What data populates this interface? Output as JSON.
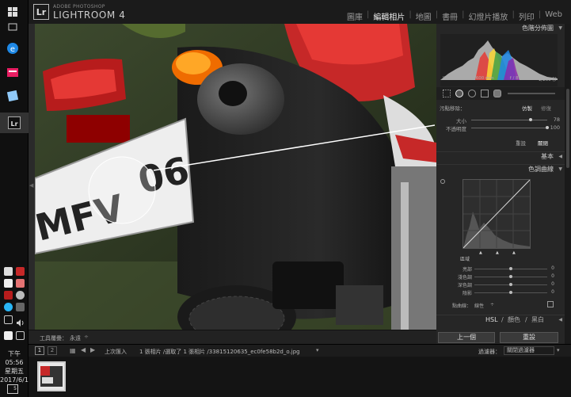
{
  "app": {
    "logo": "Lr",
    "brand_top": "ADOBE PHOTOSHOP",
    "brand_name": "LIGHTROOM 4"
  },
  "modules": [
    {
      "label": "圖庫",
      "active": false
    },
    {
      "label": "編輯相片",
      "active": true
    },
    {
      "label": "地圖",
      "active": false
    },
    {
      "label": "書冊",
      "active": false
    },
    {
      "label": "幻燈片播放",
      "active": false
    },
    {
      "label": "列印",
      "active": false
    },
    {
      "label": "Web",
      "active": false
    }
  ],
  "panel": {
    "histogram_title": "色階分佈圖",
    "histogram_info": [
      "ISO 400",
      "600 mm",
      "f / 8.0",
      "1/200 秒"
    ],
    "spot": {
      "mode_label": "污點移除：",
      "mode_clone": "仿製",
      "mode_heal": "修復",
      "size_label": "大小",
      "size_value": "78",
      "size_fraction": 0.78,
      "opacity_label": "不透明度",
      "opacity_value": "100",
      "opacity_fraction": 1.0,
      "reset": "重設",
      "close": "關閉"
    },
    "basic_title": "基本",
    "tone_curve_title": "色調曲線",
    "region_label": "區域",
    "curve_rows": [
      {
        "label": "亮部",
        "value": "0",
        "fraction": 0.5
      },
      {
        "label": "淺色調",
        "value": "0",
        "fraction": 0.5
      },
      {
        "label": "深色調",
        "value": "0",
        "fraction": 0.5
      },
      {
        "label": "陰影",
        "value": "0",
        "fraction": 0.5
      }
    ],
    "point_curve_label": "點曲線：",
    "point_curve_value": "線性",
    "hsl_tabs": [
      "HSL",
      "顏色",
      "黑白"
    ],
    "prev_button": "上一個",
    "reset_button": "重設"
  },
  "toolbar": {
    "label": "工具覆疊：",
    "value": "永遠"
  },
  "filmstrip": {
    "page1": "1",
    "page2": "2",
    "source": "上次匯入",
    "count": "1 張相片 /選取了 1 張相片 /33815120635_ec0fe58b2d_o.jpg",
    "filter_label": "過濾器：",
    "filter_value": "關閉過濾器"
  },
  "taskbar": {
    "time": "下午 05:56",
    "weekday": "星期五",
    "date": "2017/6/16",
    "notification_count": "5"
  },
  "photo": {
    "plate_text": "MFV",
    "plate_number": "06"
  }
}
